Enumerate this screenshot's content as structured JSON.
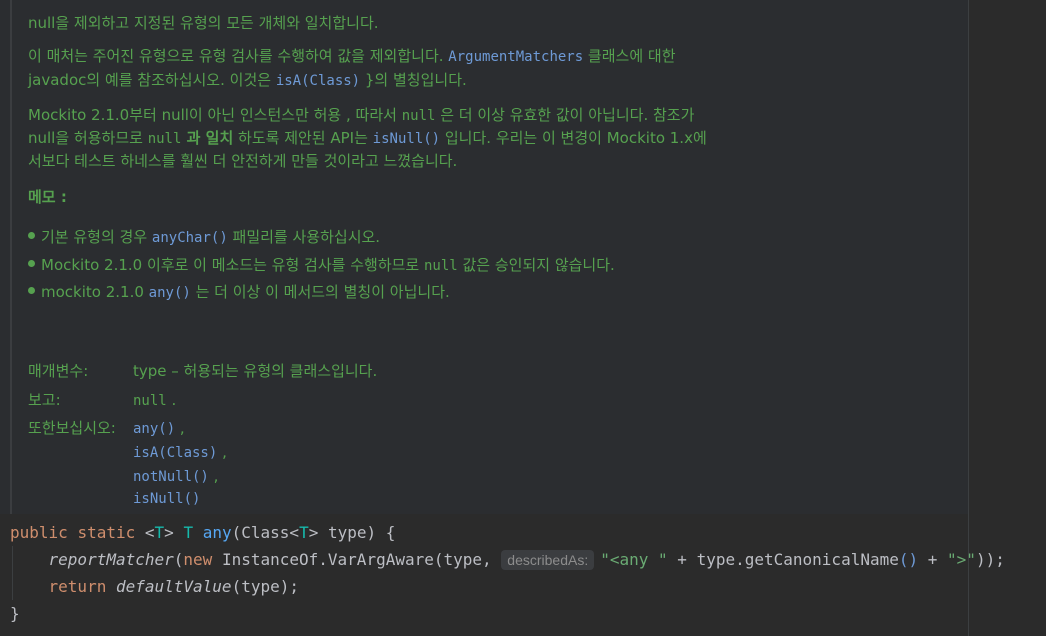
{
  "doc": {
    "summary": "null을 제외하고 지정된 유형의 모든 개체와 일치합니다.",
    "p1_line1_a": "이 매처는 주어진 유형으로 유형 검사를 수행하여 값을 제외합니다. ",
    "p1_line1_code": "ArgumentMatchers",
    "p1_line1_b": " 클래스에 대한",
    "p1_line2_a": "javadoc의 예를 참조하십시오. 이것은 ",
    "p1_line2_code": "isA(Class)",
    "p1_line2_b": " }의 별칭입니다.",
    "p2_line1_a": "Mockito 2.1.0부터 null이 아닌 인스턴스만 허용 , 따라서 ",
    "p2_line1_code": "null",
    "p2_line1_b": " 은 더 이상 유효한 값이 아닙니다. 참조가",
    "p2_line2_a": "null을 허용하므로 ",
    "p2_line2_code": "null",
    "p2_line2_strong": " 과 일치",
    "p2_line2_b": " 하도록 제안된 API는 ",
    "p2_line2_code2": "isNull()",
    "p2_line2_c": " 입니다. 우리는 이 변경이 Mockito 1.x에",
    "p2_line3": "서보다 테스트 하네스를 훨씬 더 안전하게 만들 것이라고 느꼈습니다.",
    "memo_heading": "메모 :",
    "bullets": [
      {
        "a": "기본 유형의 경우 ",
        "code": "anyChar()",
        "b": " 패밀리를 사용하십시오."
      },
      {
        "a": "Mockito 2.1.0 이후로 이 메소드는 유형 검사를 수행하므로 ",
        "code": "null",
        "b": " 값은 승인되지 않습니다."
      },
      {
        "a": "mockito 2.1.0 ",
        "code": "any()",
        "b": " 는 더 이상 이 메서드의 별칭이 아닙니다."
      }
    ],
    "params_label": "매개변수:",
    "params_value": "type – 허용되는 유형의 클래스입니다.",
    "returns_label": "보고:",
    "returns_value": "null",
    "returns_suffix": " .",
    "see_label": "또한보십시오:",
    "see_items": [
      "any()",
      "isA(Class)",
      "notNull()",
      "isNull()"
    ],
    "see_separator": " ,"
  },
  "code": {
    "line1": {
      "kw_public": "public",
      "kw_static": "static",
      "tp_open": "<",
      "tp_T": "T",
      "tp_close": ">",
      "ret_T": "T",
      "fn_name": "any",
      "params": "(Class<",
      "params_T": "T",
      "params_rest": "> type) {"
    },
    "line2": {
      "call": "reportMatcher",
      "open": "(",
      "kw_new": "new",
      "ctor": " InstanceOf.VarArgAware(type, ",
      "hint": "describedAs:",
      "str1": "\"<any \"",
      "plus1": " + type.getCanonicalName",
      "paren": "()",
      "plus2": " + ",
      "str2": "\">\"",
      "close": "));"
    },
    "line3": {
      "kw_return": "return",
      "call": "defaultValue",
      "args": "(type);"
    },
    "line4": "}"
  }
}
